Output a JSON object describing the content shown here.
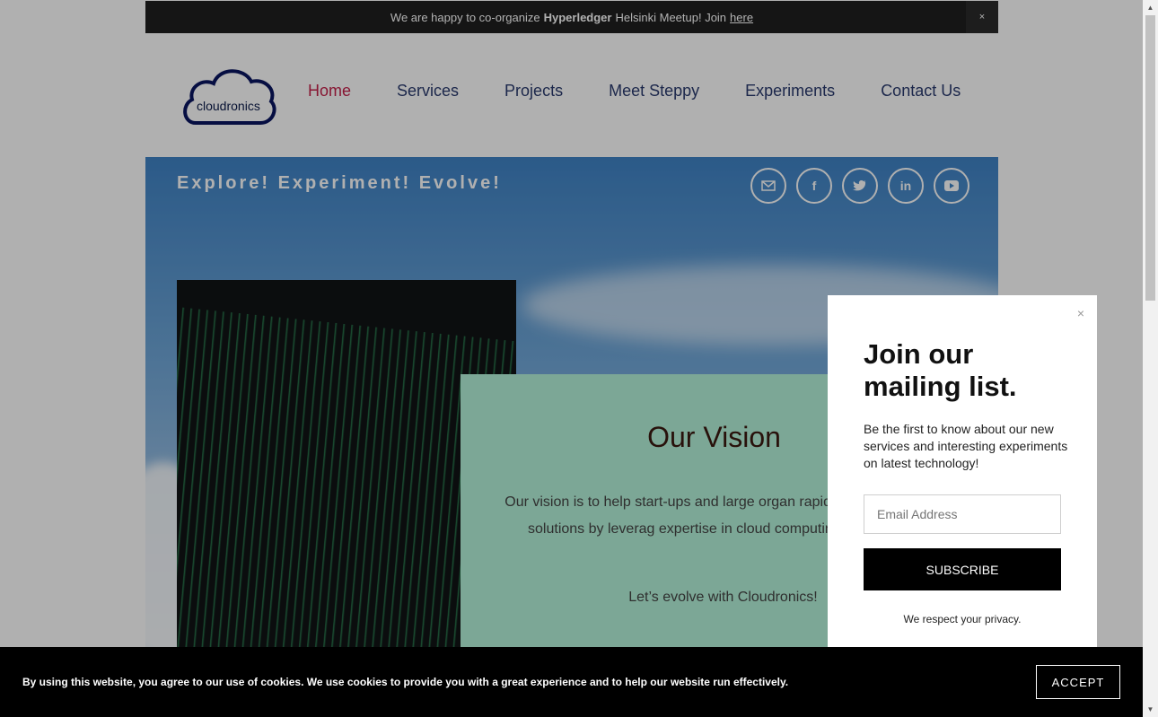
{
  "announcement": {
    "prefix": "We are happy to co-organize",
    "highlight": "Hyperledger",
    "suffix": "Helsinki Meetup! Join",
    "link": "here",
    "close": "×"
  },
  "brand": {
    "logo_text": "cloudronics"
  },
  "nav": [
    "Home",
    "Services",
    "Projects",
    "Meet Steppy",
    "Experiments",
    "Contact Us"
  ],
  "hero": {
    "tagline": "Explore! Experiment! Evolve!",
    "socials": [
      "mail-icon",
      "facebook-icon",
      "twitter-icon",
      "linkedin-icon",
      "youtube-icon"
    ]
  },
  "vision": {
    "title": "Our Vision",
    "text": "Our vision is to help start-ups and large organ rapidly build and scale solutions by leverag expertise in cloud computing,AI and Bloc",
    "tagline": "Let’s evolve with Cloudronics!"
  },
  "popup": {
    "close": "×",
    "title": "Join our mailing list.",
    "description": "Be the first to know about our new services and interesting experiments on latest technology!",
    "email_placeholder": "Email Address",
    "subscribe": "SUBSCRIBE",
    "privacy": "We respect your privacy."
  },
  "cookie": {
    "text": "By using this website, you agree to our use of cookies. We use cookies to provide you with a great experience and to help our website run effectively.",
    "accept": "ACCEPT"
  },
  "colors": {
    "nav_active": "#c4204a",
    "nav": "#2a3b6e",
    "vision_bg": "#b4f2d9"
  }
}
